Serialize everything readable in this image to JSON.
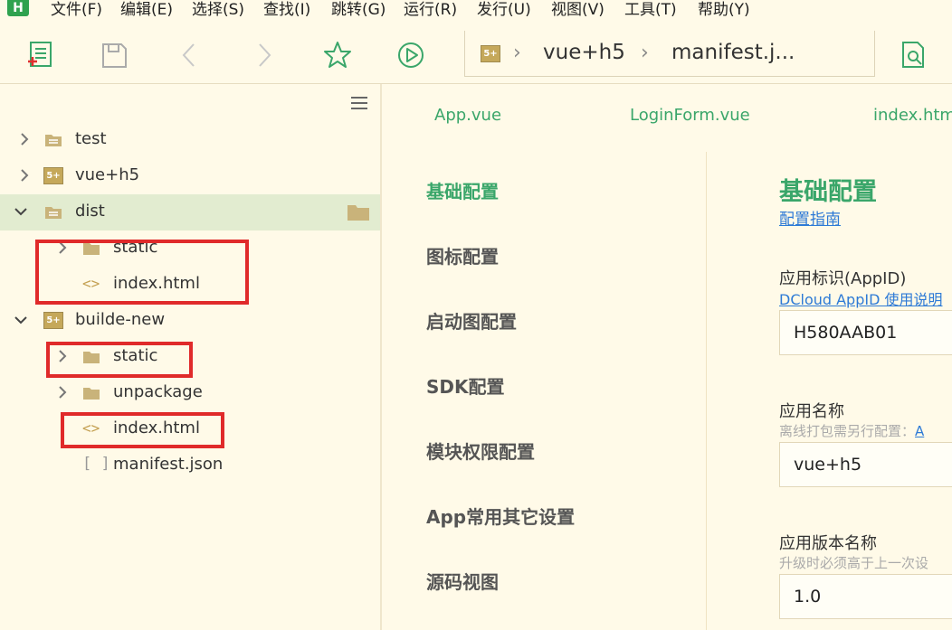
{
  "menubar": {
    "logo": "H",
    "items": [
      "文件(F)",
      "编辑(E)",
      "选择(S)",
      "查找(I)",
      "跳转(G)",
      "运行(R)",
      "发行(U)",
      "视图(V)",
      "工具(T)",
      "帮助(Y)"
    ]
  },
  "toolbar": {
    "icons": [
      "new-file-icon",
      "save-icon",
      "back-icon",
      "forward-icon",
      "star-icon",
      "run-icon",
      "search-file-icon"
    ],
    "breadcrumb": {
      "badge": "5+",
      "segments": [
        "vue+h5",
        "manifest.j..."
      ]
    }
  },
  "sidebar": {
    "tree": [
      {
        "label": "test",
        "icon": "folder-project-icon"
      },
      {
        "label": "vue+h5",
        "icon": "uniapp-project-icon"
      },
      {
        "label": "dist",
        "icon": "folder-project-icon"
      },
      {
        "label": "static",
        "icon": "folder-icon"
      },
      {
        "label": "index.html",
        "icon": "code-file-icon"
      },
      {
        "label": "builde-new",
        "icon": "uniapp-project-icon"
      },
      {
        "label": "static",
        "icon": "folder-icon"
      },
      {
        "label": "unpackage",
        "icon": "folder-icon"
      },
      {
        "label": "index.html",
        "icon": "code-file-icon"
      },
      {
        "label": "manifest.json",
        "icon": "json-file-icon"
      }
    ],
    "code_glyph": "<>",
    "json_glyph": "[ ]"
  },
  "editor": {
    "tabs": [
      "App.vue",
      "LoginForm.vue",
      "index.html"
    ],
    "nav": [
      "基础配置",
      "图标配置",
      "启动图配置",
      "SDK配置",
      "模块权限配置",
      "App常用其它设置",
      "源码视图"
    ],
    "active_nav": "基础配置",
    "form": {
      "section_title": "基础配置",
      "guide_link": "配置指南",
      "appid": {
        "label": "应用标识(AppID)",
        "link": "DCloud AppID 使用说明",
        "value": "H580AAB01"
      },
      "app_name": {
        "label": "应用名称",
        "hint": "离线打包需另行配置：",
        "hint_link": "A",
        "value": "vue+h5"
      },
      "version_name": {
        "label": "应用版本名称",
        "hint": "升级时必须高于上一次设",
        "value": "1.0"
      }
    }
  },
  "colors": {
    "accent": "#3aa66a",
    "highlight": "#e02a2a",
    "background": "#fffae8",
    "selected_row": "#e2ecd0"
  }
}
